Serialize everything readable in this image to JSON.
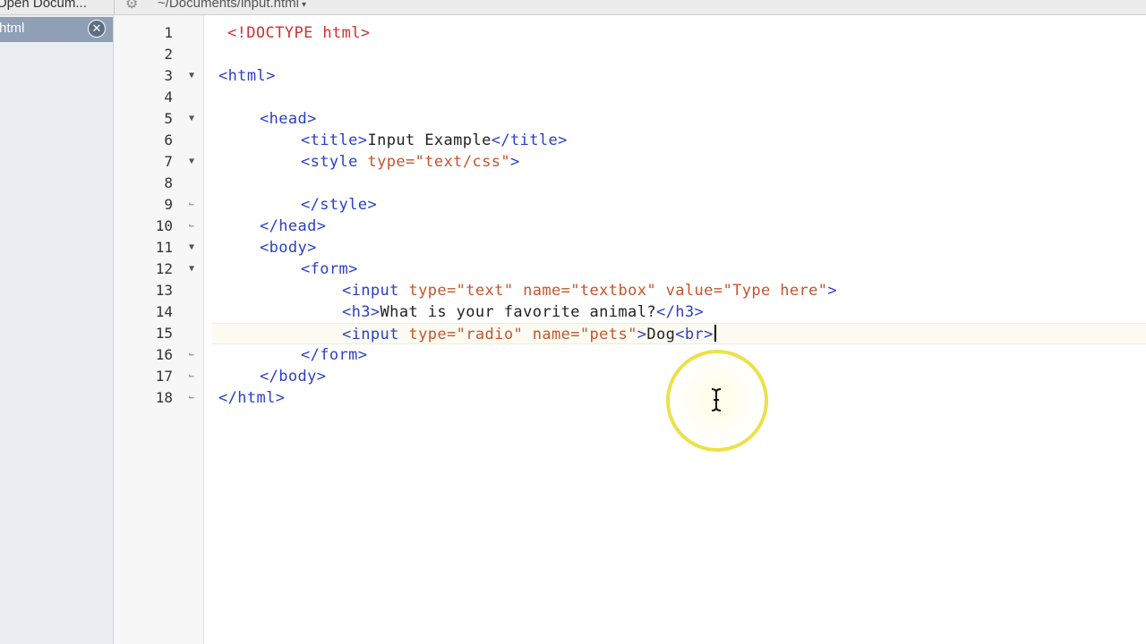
{
  "topbar": {
    "open_documents_label": "Open Docum...",
    "path": "~/Documents/input.html",
    "gear_icon": "gear-icon"
  },
  "sidebar": {
    "document_label": "html",
    "close_icon": "close-icon"
  },
  "editor": {
    "current_line": 15,
    "lines": [
      {
        "n": "1"
      },
      {
        "n": "2"
      },
      {
        "n": "3"
      },
      {
        "n": "4"
      },
      {
        "n": "5"
      },
      {
        "n": "6"
      },
      {
        "n": "7"
      },
      {
        "n": "8"
      },
      {
        "n": "9"
      },
      {
        "n": "10"
      },
      {
        "n": "11"
      },
      {
        "n": "12"
      },
      {
        "n": "13"
      },
      {
        "n": "14"
      },
      {
        "n": "15"
      },
      {
        "n": "16"
      },
      {
        "n": "17"
      },
      {
        "n": "18"
      }
    ],
    "tokens": {
      "l1": [
        "<!DOCTYPE html>"
      ],
      "l3": [
        "<html>"
      ],
      "l5": [
        "<head>"
      ],
      "l6": [
        "<title>",
        "Input Example",
        "</title>"
      ],
      "l7": [
        "<style ",
        "type=",
        "\"text/css\"",
        ">"
      ],
      "l9": [
        "</style>"
      ],
      "l10": [
        "</head>"
      ],
      "l11": [
        "<body>"
      ],
      "l12": [
        "<form>"
      ],
      "l13": [
        "<input ",
        "type=",
        "\"text\"",
        " name=",
        "\"textbox\"",
        " value=",
        "\"Type here\"",
        ">"
      ],
      "l14": [
        "<h3>",
        "What is your favorite animal?",
        "</h3>"
      ],
      "l15": [
        "<input ",
        "type=",
        "\"radio\"",
        " name=",
        "\"pets\"",
        ">",
        "Dog",
        "<br>"
      ],
      "l16": [
        "</form>"
      ],
      "l17": [
        "</body>"
      ],
      "l18": [
        "</html>"
      ]
    }
  },
  "colors": {
    "doctype": "#d0312d",
    "tag": "#2b3fc5",
    "attribute": "#c8542c",
    "text": "#222222",
    "cursor_highlight": "#ede04a"
  }
}
